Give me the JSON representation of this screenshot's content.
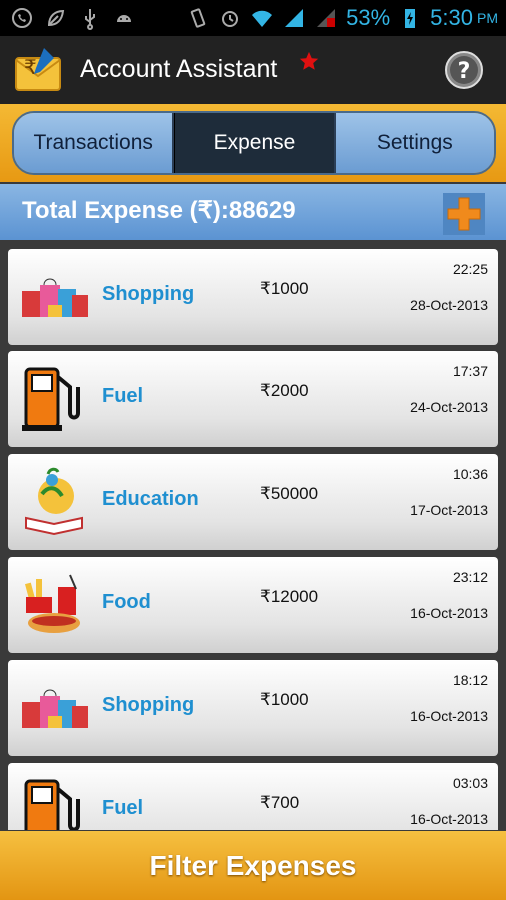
{
  "statusbar": {
    "battery": "53%",
    "time": "5:30",
    "ampm": "PM"
  },
  "app": {
    "title": "Account Assistant"
  },
  "tabs": [
    {
      "label": "Transactions"
    },
    {
      "label": "Expense"
    },
    {
      "label": "Settings"
    }
  ],
  "total": {
    "label": "Total Expense (₹):88629"
  },
  "expenses": [
    {
      "category": "Shopping",
      "amount": "₹1000",
      "time": "22:25",
      "date": "28-Oct-2013",
      "icon": "shopping-bags-icon"
    },
    {
      "category": "Fuel",
      "amount": "₹2000",
      "time": "17:37",
      "date": "24-Oct-2013",
      "icon": "fuel-pump-icon"
    },
    {
      "category": "Education",
      "amount": "₹50000",
      "time": "10:36",
      "date": "17-Oct-2013",
      "icon": "education-icon"
    },
    {
      "category": "Food",
      "amount": "₹12000",
      "time": "23:12",
      "date": "16-Oct-2013",
      "icon": "fast-food-icon"
    },
    {
      "category": "Shopping",
      "amount": "₹1000",
      "time": "18:12",
      "date": "16-Oct-2013",
      "icon": "shopping-bags-icon"
    },
    {
      "category": "Fuel",
      "amount": "₹700",
      "time": "03:03",
      "date": "16-Oct-2013",
      "icon": "fuel-pump-icon"
    }
  ],
  "filter": {
    "label": "Filter Expenses"
  },
  "colors": {
    "accent": "#33b5e5",
    "category": "#1f8fd0",
    "orange": "#e79913"
  }
}
